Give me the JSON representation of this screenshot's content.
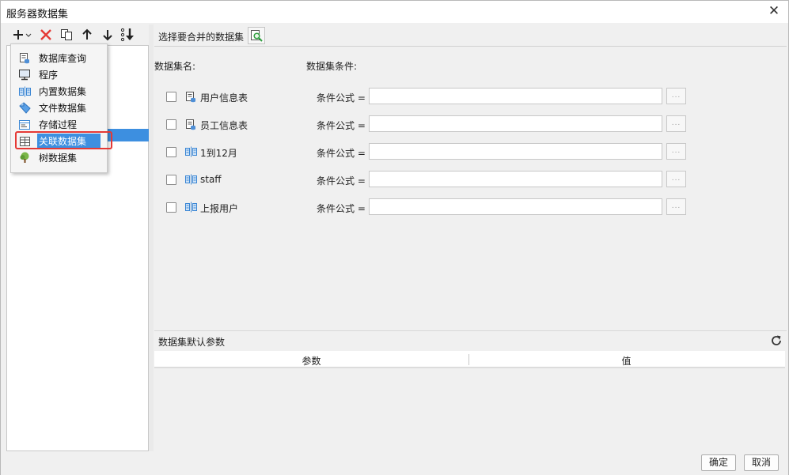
{
  "window": {
    "title": "服务器数据集"
  },
  "toolbar": {
    "add_icon": "plus-dropdown-icon",
    "delete_icon": "red-x-icon",
    "copy_icon": "copy-icon",
    "up_icon": "arrow-up-icon",
    "down_icon": "arrow-down-icon",
    "sort_icon": "sort-icon"
  },
  "menu": {
    "items": [
      {
        "label": "数据库查询",
        "icon": "database-query-icon"
      },
      {
        "label": "程序",
        "icon": "monitor-icon"
      },
      {
        "label": "内置数据集",
        "icon": "builtin-dataset-icon"
      },
      {
        "label": "文件数据集",
        "icon": "file-dataset-icon"
      },
      {
        "label": "存储过程",
        "icon": "stored-procedure-icon"
      },
      {
        "label": "关联数据集",
        "icon": "join-dataset-icon",
        "selected": true
      },
      {
        "label": "树数据集",
        "icon": "tree-dataset-icon"
      }
    ]
  },
  "right": {
    "header_title": "选择要合并的数据集",
    "col_name_label": "数据集名:",
    "col_condition_label": "数据集条件:",
    "rows": [
      {
        "name": "用户信息表",
        "icon": "database-query-icon",
        "cond_label": "条件公式",
        "eq": "=",
        "value": "",
        "checked": false
      },
      {
        "name": "员工信息表",
        "icon": "database-query-icon",
        "cond_label": "条件公式",
        "eq": "=",
        "value": "",
        "checked": false
      },
      {
        "name": "1到12月",
        "icon": "builtin-dataset-icon",
        "cond_label": "条件公式",
        "eq": "=",
        "value": "",
        "checked": false
      },
      {
        "name": "staff",
        "icon": "builtin-dataset-icon",
        "cond_label": "条件公式",
        "eq": "=",
        "value": "",
        "checked": false
      },
      {
        "name": "上报用户",
        "icon": "builtin-dataset-icon",
        "cond_label": "条件公式",
        "eq": "=",
        "value": "",
        "checked": false
      }
    ],
    "ellipsis": "...",
    "params_title": "数据集默认参数",
    "params_col_param": "参数",
    "params_col_value": "值"
  },
  "footer": {
    "ok": "确定",
    "cancel": "取消"
  },
  "colors": {
    "accent": "#3d8fe0",
    "highlight": "#e53935",
    "delete": "#e53935"
  }
}
